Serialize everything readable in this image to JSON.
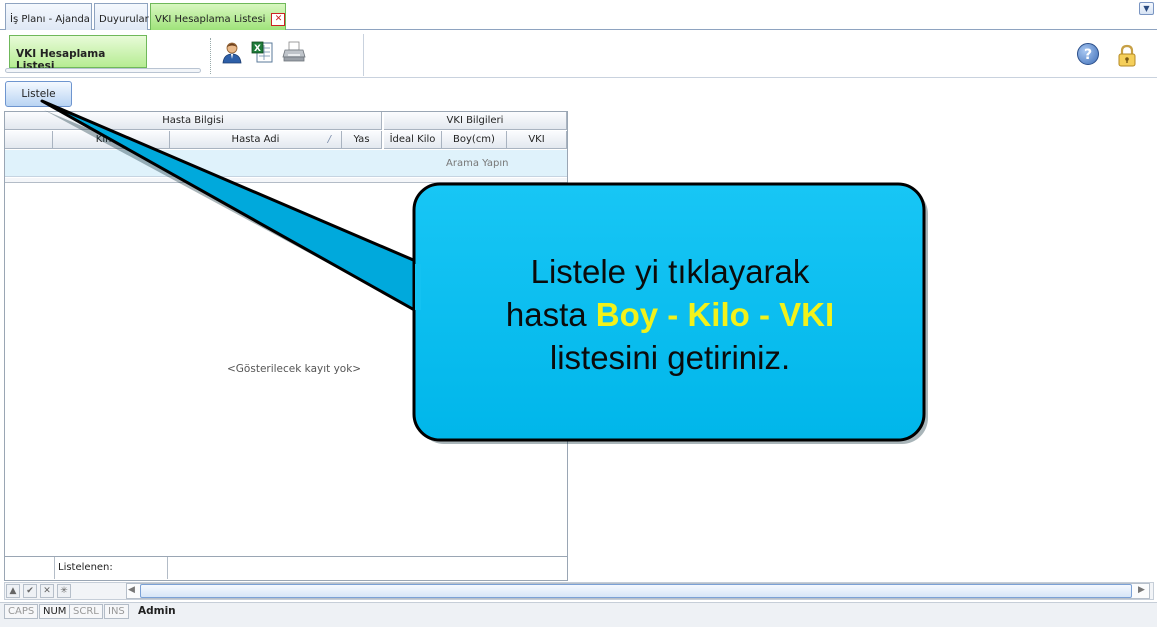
{
  "tabs": [
    {
      "label": "İş Planı - Ajanda"
    },
    {
      "label": "Duyurular"
    },
    {
      "label": "VKI Hesaplama Listesi",
      "active": true
    }
  ],
  "toolbar": {
    "title": "VKI Hesaplama Listesi",
    "icons": [
      "patient-icon",
      "excel-export-icon",
      "print-icon"
    ],
    "right_icons": [
      "help-icon",
      "lock-icon"
    ],
    "help_glyph": "?"
  },
  "actions": {
    "list_button": "Listele"
  },
  "grid": {
    "bands": [
      "Hasta Bilgisi",
      "VKI Bilgileri"
    ],
    "columns": [
      "Kimlik",
      "Hasta Adi",
      "Yas",
      "İdeal Kilo",
      "Boy(cm)",
      "VKI"
    ],
    "sort_indicator": "/",
    "search_placeholder": "Arama Yapın",
    "empty_text": "<Gösterilecek kayıt yok>",
    "footer_label": "Listelenen:"
  },
  "status": {
    "keys": [
      {
        "label": "CAPS",
        "on": false
      },
      {
        "label": "NUM",
        "on": true
      },
      {
        "label": "SCRL",
        "on": false
      },
      {
        "label": "INS",
        "on": false
      }
    ],
    "user": "Admin"
  },
  "callout": {
    "line1": "Listele yi tıklayarak",
    "line2_prefix": "hasta ",
    "line2_highlight": "Boy - Kilo - VKI",
    "line3": "listesini getiriniz.",
    "fill_color": "#00bfef",
    "highlight_color": "#f2f21a"
  },
  "colors": {
    "active_tab": "#9fe37a",
    "search_row": "#dff2fb",
    "accent": "#3f6fb8"
  }
}
